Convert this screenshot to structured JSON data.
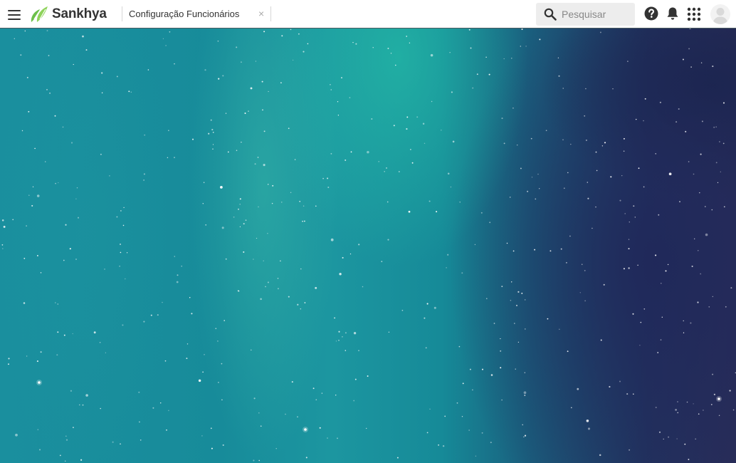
{
  "header": {
    "logo_text": "Sankhya",
    "brand_color": "#6cc04a",
    "menu_icon": "hamburger-icon",
    "tabs": [
      {
        "label": "Configuração Funcionários",
        "close_glyph": "×"
      }
    ],
    "search": {
      "placeholder": "Pesquisar",
      "value": "",
      "icon": "search-icon"
    },
    "actions": [
      {
        "name": "help",
        "icon": "help-icon"
      },
      {
        "name": "notifications",
        "icon": "bell-icon"
      },
      {
        "name": "apps",
        "icon": "apps-grid-icon"
      },
      {
        "name": "user",
        "icon": "user-avatar-icon"
      }
    ]
  },
  "main": {
    "background": "aurora-wallpaper"
  }
}
